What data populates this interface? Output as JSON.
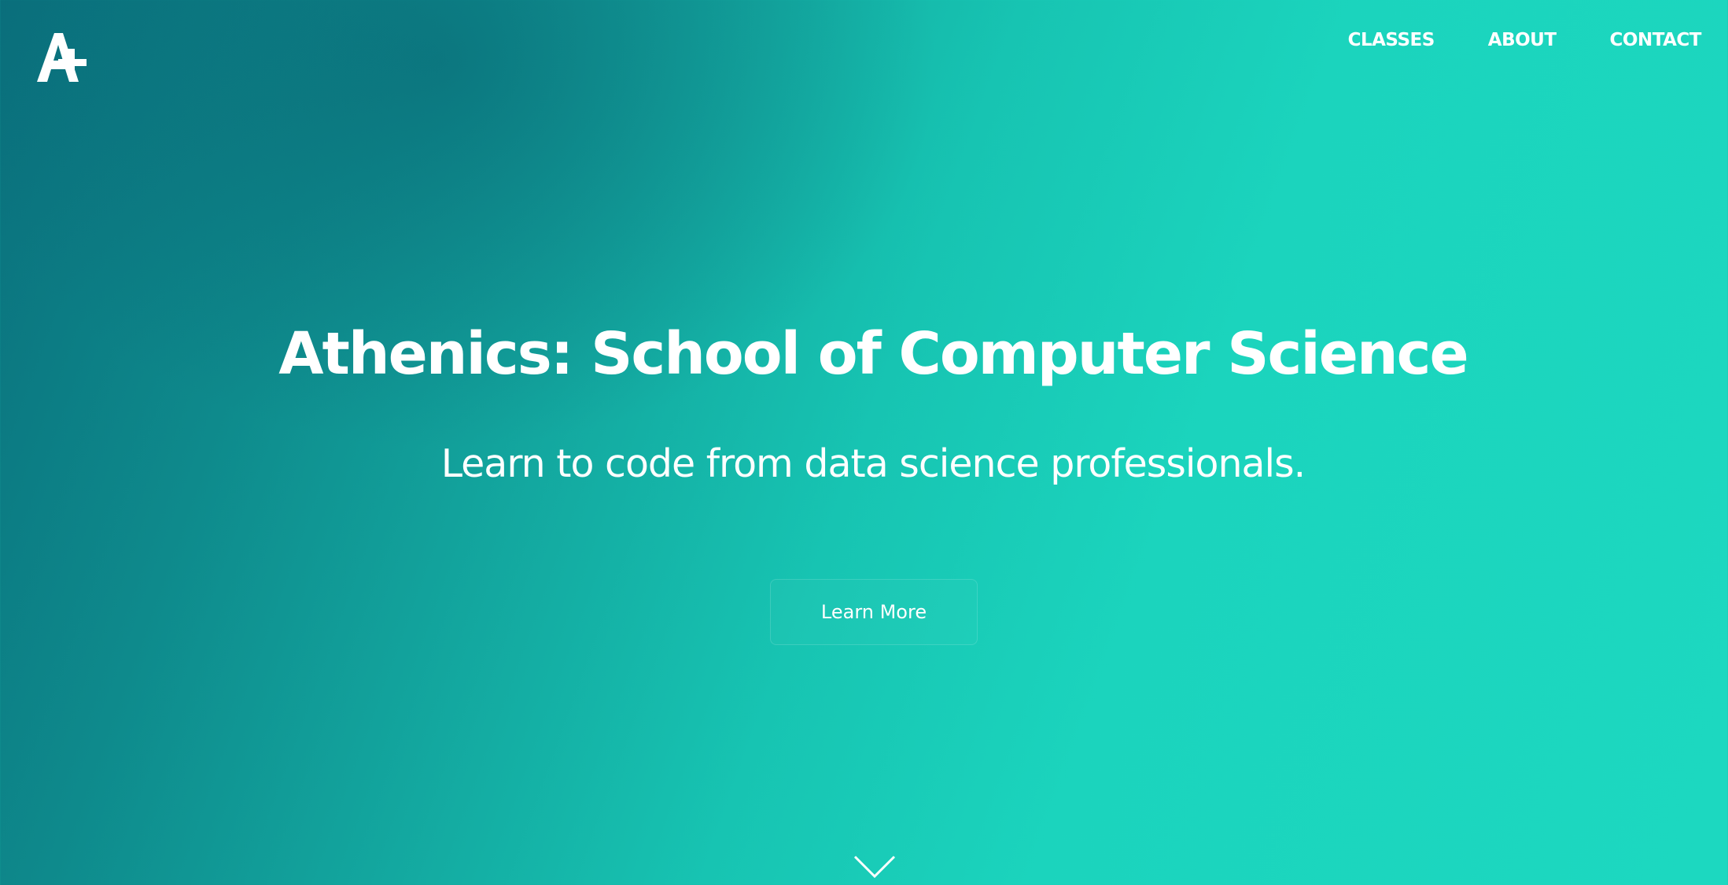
{
  "brand": {
    "logo_icon": "a-plus-logo-icon",
    "accent_color": "#1cd8c0",
    "dark_color": "#0a6f7c"
  },
  "nav": {
    "items": [
      {
        "label": "CLASSES"
      },
      {
        "label": "ABOUT"
      },
      {
        "label": "CONTACT"
      }
    ]
  },
  "hero": {
    "title": "Athenics: School of Computer Science",
    "subtitle": "Learn to code from data science professionals.",
    "cta_label": "Learn More",
    "scroll_icon": "chevron-down-icon"
  }
}
